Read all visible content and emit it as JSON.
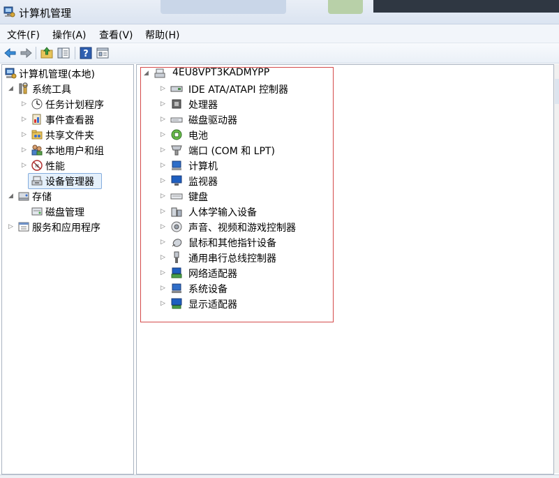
{
  "window": {
    "title": "计算机管理"
  },
  "menu": [
    "文件(F)",
    "操作(A)",
    "查看(V)",
    "帮助(H)"
  ],
  "toolbar": {
    "icons": [
      "back-arrow-icon",
      "forward-arrow-icon",
      "up-folder-icon",
      "show-hide-tree-icon",
      "help-icon",
      "properties-icon"
    ]
  },
  "left_tree": {
    "root": "计算机管理(本地)",
    "system_tools": "系统工具",
    "task_scheduler": "任务计划程序",
    "event_viewer": "事件查看器",
    "shared_folders": "共享文件夹",
    "local_users": "本地用户和组",
    "performance": "性能",
    "device_manager": "设备管理器",
    "storage": "存储",
    "disk_management": "磁盘管理",
    "services_apps": "服务和应用程序"
  },
  "device_tree": {
    "computer_name": "4EU8VPT3KADMYPP",
    "categories": [
      "IDE ATA/ATAPI 控制器",
      "处理器",
      "磁盘驱动器",
      "电池",
      "端口 (COM 和 LPT)",
      "计算机",
      "监视器",
      "键盘",
      "人体学输入设备",
      "声音、视频和游戏控制器",
      "鼠标和其他指针设备",
      "通用串行总线控制器",
      "网络适配器",
      "系统设备",
      "显示适配器"
    ]
  },
  "colors": {
    "selection": "#e5f0fb",
    "selection_border": "#84acdd",
    "highlight_box": "#d44a4a"
  }
}
